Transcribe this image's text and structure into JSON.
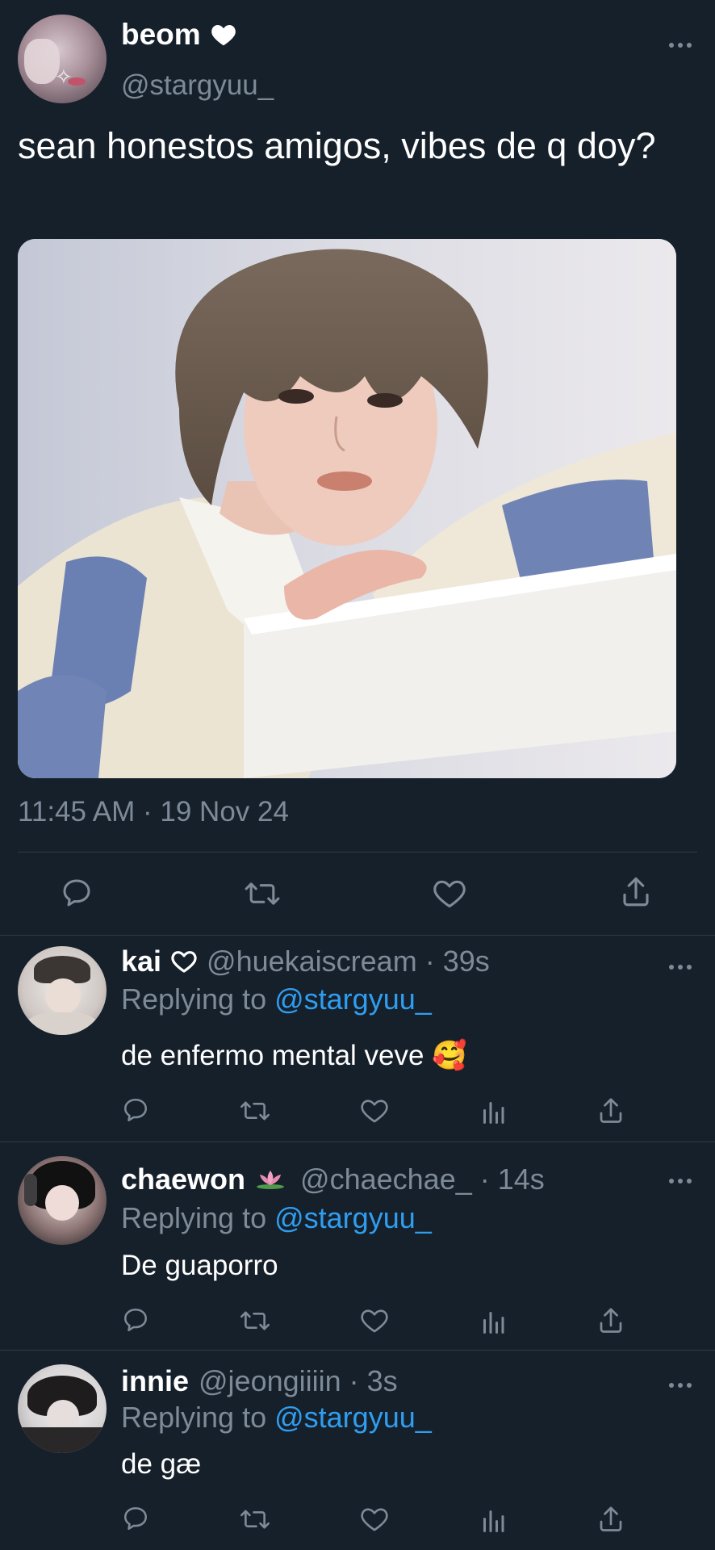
{
  "tweet": {
    "display_name": "beom",
    "handle": "@stargyuu_",
    "text": "sean honestos amigos, vibes de q doy?",
    "timestamp": "11:45 AM · 19 Nov 24"
  },
  "replies": [
    {
      "name": "kai",
      "handle": "@huekaiscream",
      "time": "· 39s",
      "replying_prefix": "Replying to",
      "replying_to": "@stargyuu_",
      "text": "de enfermo mental veve 🥰"
    },
    {
      "name": "chaewon",
      "handle": "@chaechae_",
      "time": "· 14s",
      "replying_prefix": "Replying to",
      "replying_to": "@stargyuu_",
      "text": "De guaporro"
    },
    {
      "name": "innie",
      "handle": "@jeongiiiin",
      "time": "· 3s",
      "replying_prefix": "Replying to",
      "replying_to": "@stargyuu_",
      "text": "de gæ"
    }
  ],
  "colors": {
    "background": "#16202b",
    "muted": "#7d8a97",
    "link": "#2f9ef0",
    "divider": "#2e3b48"
  },
  "icons": [
    "heart-icon",
    "more-icon",
    "reply-icon",
    "retweet-icon",
    "like-icon",
    "share-icon",
    "analytics-icon",
    "lotus-icon"
  ]
}
